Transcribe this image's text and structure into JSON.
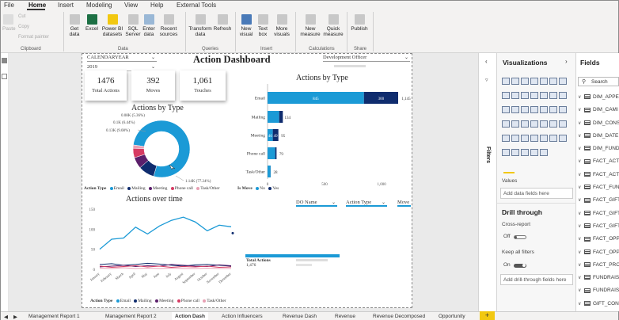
{
  "menu": {
    "file": "File",
    "home": "Home",
    "insert": "Insert",
    "modeling": "Modeling",
    "view": "View",
    "help": "Help",
    "external_tools": "External Tools"
  },
  "ribbon": {
    "clipboard": {
      "paste": "Paste",
      "cut": "Cut",
      "copy": "Copy",
      "format_painter": "Format painter",
      "group": "Clipboard"
    },
    "data": {
      "get_data": "Get data",
      "excel": "Excel",
      "power_bi": "Power BI datasets",
      "sql": "SQL Server",
      "enter": "Enter data",
      "recent": "Recent sources",
      "group": "Data"
    },
    "queries": {
      "transform": "Transform data",
      "refresh": "Refresh",
      "group": "Queries"
    },
    "insert": {
      "new_visual": "New visual",
      "text_box": "Text box",
      "more_visuals": "More visuals",
      "group": "Insert"
    },
    "calculations": {
      "new_measure": "New measure",
      "quick_measure": "Quick measure",
      "group": "Calculations"
    },
    "share": {
      "publish": "Publish",
      "group": "Share"
    }
  },
  "dashboard": {
    "title": "Action Dashboard",
    "slicer_year": {
      "label": "CALENDARYEAR",
      "value": "2019"
    },
    "slicer_officer": {
      "label": "Development Officer"
    },
    "cards": [
      {
        "value": "1476",
        "label": "Total Actions"
      },
      {
        "value": "392",
        "label": "Moves"
      },
      {
        "value": "1,061",
        "label": "Touches"
      }
    ],
    "donut": {
      "title": "Actions by Type",
      "legend_title": "Action Type",
      "legend": [
        "Email",
        "Mailing",
        "Meeting",
        "Phone call",
        "Task/Other"
      ]
    },
    "bar": {
      "title": "Actions by Type",
      "legend_title": "Is Move",
      "legend": [
        "No",
        "Yes"
      ]
    },
    "line": {
      "title": "Actions over time",
      "legend_title": "Action Type",
      "legend": [
        "Email",
        "Mailing",
        "Meeting",
        "Phone call",
        "Task/Other"
      ]
    },
    "table_headers": [
      "DO Name",
      "Action Type",
      "Move"
    ],
    "table_total": "Total Actions",
    "table_total_value": "1,476"
  },
  "chart_data": [
    {
      "type": "pie",
      "title": "Actions by Type",
      "categories": [
        "Email",
        "Mailing",
        "Meeting",
        "Phone call",
        "Task/Other"
      ],
      "values": [
        1140,
        134,
        95,
        79,
        28
      ],
      "labels": [
        "1.14K (77.24%)",
        "0.13K (9.08%)",
        "0.1K (6.44%)",
        "0.08K (5.36%)",
        ""
      ],
      "colors": [
        "#1b9ad6",
        "#0f2c6e",
        "#5b1f6b",
        "#d63b63",
        "#e8a0b4"
      ]
    },
    {
      "type": "bar",
      "orientation": "horizontal",
      "stacked": true,
      "title": "Actions by Type",
      "categories": [
        "Email",
        "Mailing",
        "Meeting",
        "Phone call",
        "Task/Other"
      ],
      "series": [
        {
          "name": "No",
          "values": [
            845,
            102,
            46,
            67,
            27
          ],
          "color": "#1b9ad6"
        },
        {
          "name": "Yes",
          "values": [
            300,
            32,
            49,
            12,
            1
          ],
          "color": "#0f2c6e"
        }
      ],
      "data_labels": [
        "845",
        "300",
        "1,145",
        "",
        "134",
        "46",
        "49",
        "95",
        "",
        "79",
        "",
        "28"
      ],
      "xticks": [
        "0",
        "500",
        "1,000"
      ],
      "xlim": [
        0,
        1145
      ]
    },
    {
      "type": "line",
      "title": "Actions over time",
      "x": [
        "January",
        "February",
        "March",
        "April",
        "May",
        "June",
        "July",
        "August",
        "September",
        "October",
        "November",
        "December"
      ],
      "series": [
        {
          "name": "Email",
          "values": [
            50,
            75,
            78,
            105,
            88,
            108,
            122,
            130,
            118,
            96,
            110,
            106
          ],
          "color": "#1b9ad6"
        },
        {
          "name": "Mailing",
          "values": [
            12,
            14,
            10,
            12,
            15,
            13,
            10,
            8,
            11,
            12,
            10,
            8
          ],
          "color": "#0f2c6e"
        },
        {
          "name": "Meeting",
          "values": [
            6,
            8,
            10,
            7,
            9,
            8,
            12,
            10,
            8,
            7,
            11,
            9
          ],
          "color": "#5b1f6b"
        },
        {
          "name": "Phone call",
          "values": [
            8,
            5,
            7,
            9,
            6,
            8,
            5,
            7,
            6,
            8,
            5,
            6
          ],
          "color": "#d63b63"
        },
        {
          "name": "Task/Other",
          "values": [
            3,
            2,
            4,
            2,
            3,
            2,
            3,
            2,
            2,
            3,
            2,
            2
          ],
          "color": "#e8a0b4"
        }
      ],
      "yticks": [
        "0",
        "50",
        "100",
        "150"
      ],
      "ylim": [
        0,
        150
      ]
    }
  ],
  "right": {
    "filters": "Filters",
    "visualizations": "Visualizations",
    "fields": "Fields",
    "search": "Search",
    "values": "Values",
    "add_data_fields": "Add data fields here",
    "drill_through": "Drill through",
    "cross_report": "Cross-report",
    "cross_off": "Off",
    "keep_filters": "Keep all filters",
    "keep_on": "On",
    "add_drill": "Add drill-through fields here",
    "field_list": [
      "DIM_APPE",
      "DIM_CAMI",
      "DIM_CONS",
      "DIM_DATE",
      "DIM_FUND",
      "FACT_ACTI",
      "FACT_ACTI",
      "FACT_FUNI",
      "FACT_GIFT",
      "FACT_GIFT",
      "FACT_GIFT",
      "FACT_OPPI",
      "FACT_OPPI",
      "FACT_PRO",
      "FUNDRAIS",
      "FUNDRAIS",
      "GIFT_CONS",
      "GIFT_DIM"
    ]
  },
  "tabs": [
    "Management Report 1",
    "Management Report 2",
    "Action Dash",
    "Action Influencers",
    "Revenue Dash",
    "Revenue",
    "Revenue Decomposed",
    "Opportunity"
  ]
}
